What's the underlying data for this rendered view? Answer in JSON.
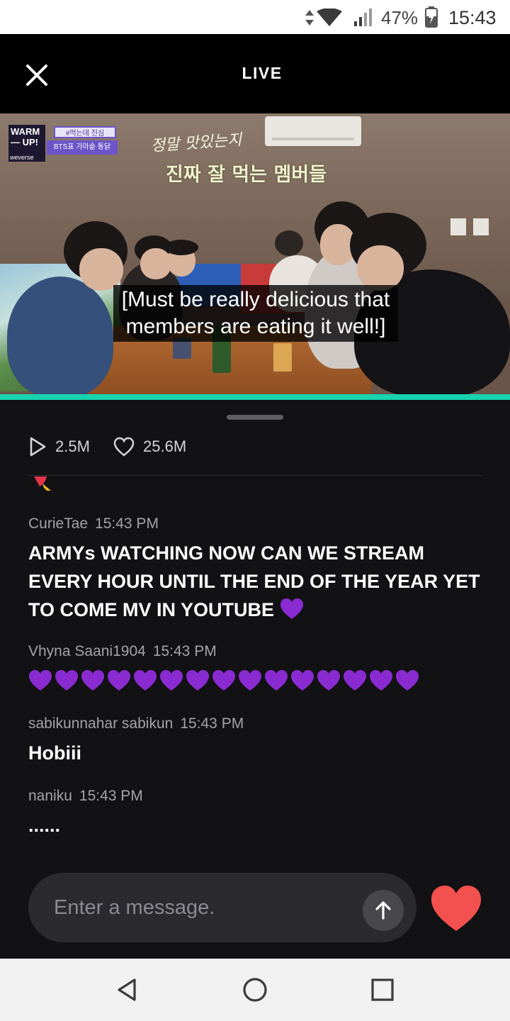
{
  "status_bar": {
    "battery_percent": "47%",
    "time": "15:43",
    "icons": [
      "data-activity-icon",
      "wifi-icon",
      "signal-icon",
      "battery-charging-icon"
    ]
  },
  "header": {
    "title": "LIVE",
    "close_icon": "close-icon"
  },
  "video": {
    "badge_show": "WARM — UP!",
    "badge_brand": "weverse",
    "badge_tag_1": "#먹는데 진심",
    "badge_tag_2": "BTS표 가마솥 통닭",
    "caption_kr_line1": "정말 맛있는지",
    "caption_kr_line2": "진짜 잘 먹는 멤버들",
    "subtitle": "[Must be really delicious that members are eating it well!]",
    "progress": 1.0,
    "progress_color": "#17d4b0"
  },
  "stats": {
    "views": "2.5M",
    "likes": "25.6M"
  },
  "chat": {
    "messages": [
      {
        "user": "CurieTae",
        "time": "15:43 PM",
        "text": "ARMYs WATCHING NOW CAN WE STREAM EVERY HOUR UNTIL THE END OF THE YEAR YET TO COME MV IN YOUTUBE",
        "trailing_emoji": "purple-heart"
      },
      {
        "user": "Vhyna Saani1904",
        "time": "15:43 PM",
        "text": "",
        "emoji_row": {
          "emoji": "purple-heart",
          "count": 15
        }
      },
      {
        "user": "sabikunnahar sabikun",
        "time": "15:43 PM",
        "text": "Hobiii"
      },
      {
        "user": "naniku",
        "time": "15:43 PM",
        "text": "......"
      }
    ]
  },
  "composer": {
    "placeholder": "Enter a message.",
    "send_icon": "arrow-up-icon",
    "like_icon": "heart-icon",
    "like_color": "#f2514f"
  },
  "nav_bar": {
    "buttons": [
      "back-icon",
      "home-icon",
      "recents-icon"
    ]
  },
  "colors": {
    "background": "#121114",
    "accent": "#17d4b0",
    "emoji_purple": "#8a2bd1"
  }
}
